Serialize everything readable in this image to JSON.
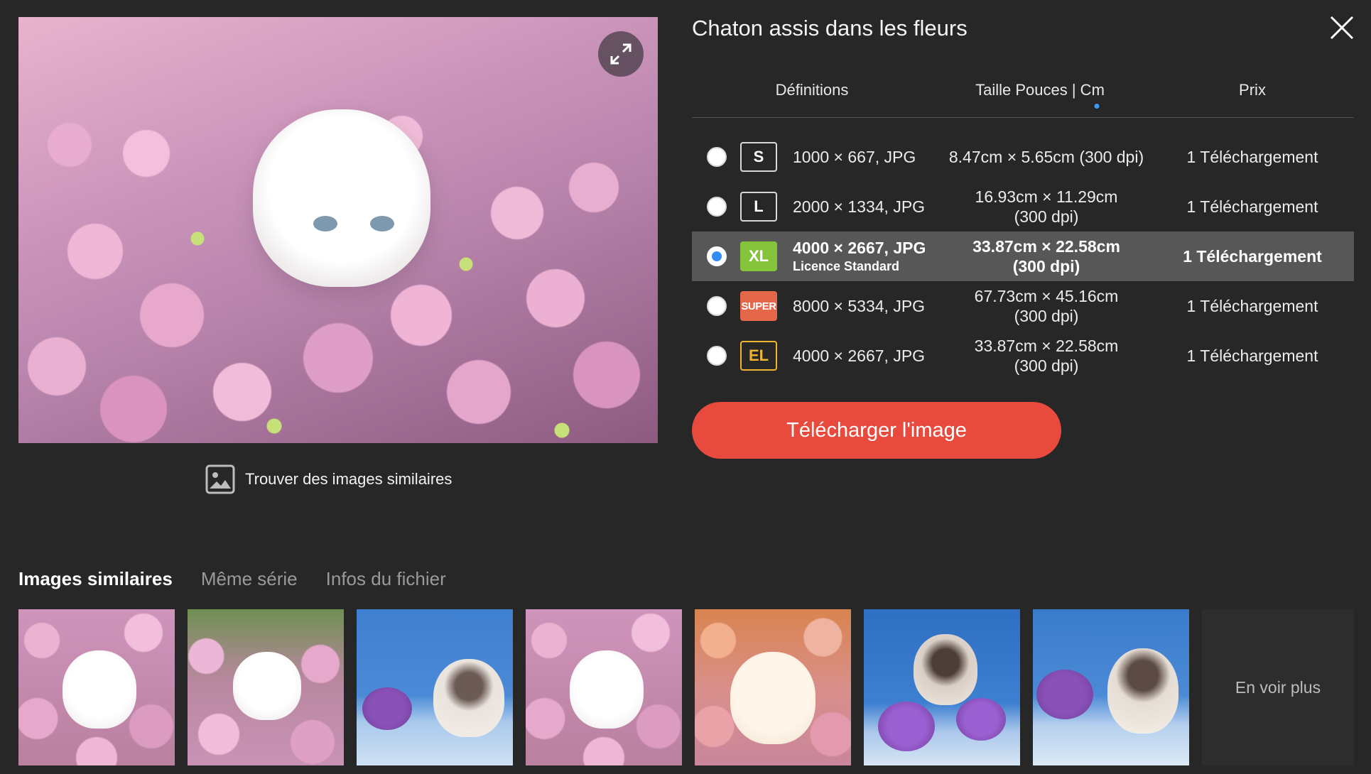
{
  "title": "Chaton assis dans les fleurs",
  "table": {
    "headers": {
      "definitions": "Définitions",
      "size": "Taille Pouces | Cm",
      "price": "Prix"
    },
    "rows": [
      {
        "badge": "S",
        "resolution": "1000 × 667, JPG",
        "license": "",
        "size_line1": "8.47cm × 5.65cm (300 dpi)",
        "size_line2": "",
        "price": "1 Téléchargement",
        "selected": false
      },
      {
        "badge": "L",
        "resolution": "2000 × 1334, JPG",
        "license": "",
        "size_line1": "16.93cm × 11.29cm",
        "size_line2": "(300 dpi)",
        "price": "1 Téléchargement",
        "selected": false
      },
      {
        "badge": "XL",
        "resolution": "4000 × 2667, JPG",
        "license": "Licence Standard",
        "size_line1": "33.87cm × 22.58cm",
        "size_line2": "(300 dpi)",
        "price": "1 Téléchargement",
        "selected": true
      },
      {
        "badge": "SUPER",
        "resolution": "8000 × 5334, JPG",
        "license": "",
        "size_line1": "67.73cm × 45.16cm",
        "size_line2": "(300 dpi)",
        "price": "1 Téléchargement",
        "selected": false
      },
      {
        "badge": "EL",
        "resolution": "4000 × 2667, JPG",
        "license": "",
        "size_line1": "33.87cm × 22.58cm",
        "size_line2": "(300 dpi)",
        "price": "1 Téléchargement",
        "selected": false
      }
    ]
  },
  "download_button": "Télécharger l'image",
  "find_similar": "Trouver des images similaires",
  "bottom_tabs": {
    "similar": "Images similaires",
    "series": "Même série",
    "file_info": "Infos du fichier"
  },
  "see_more": "En voir plus",
  "colors": {
    "background": "#272727",
    "download_button": "#e84a3e",
    "badge_xl": "#84c33a",
    "badge_super": "#e5674a",
    "badge_el": "#f0b431",
    "radio_selected": "#2f8cf5",
    "row_selected": "#575757"
  },
  "icons": {
    "expand": "expand-icon",
    "close": "close-icon",
    "find_similar": "image-icon"
  }
}
